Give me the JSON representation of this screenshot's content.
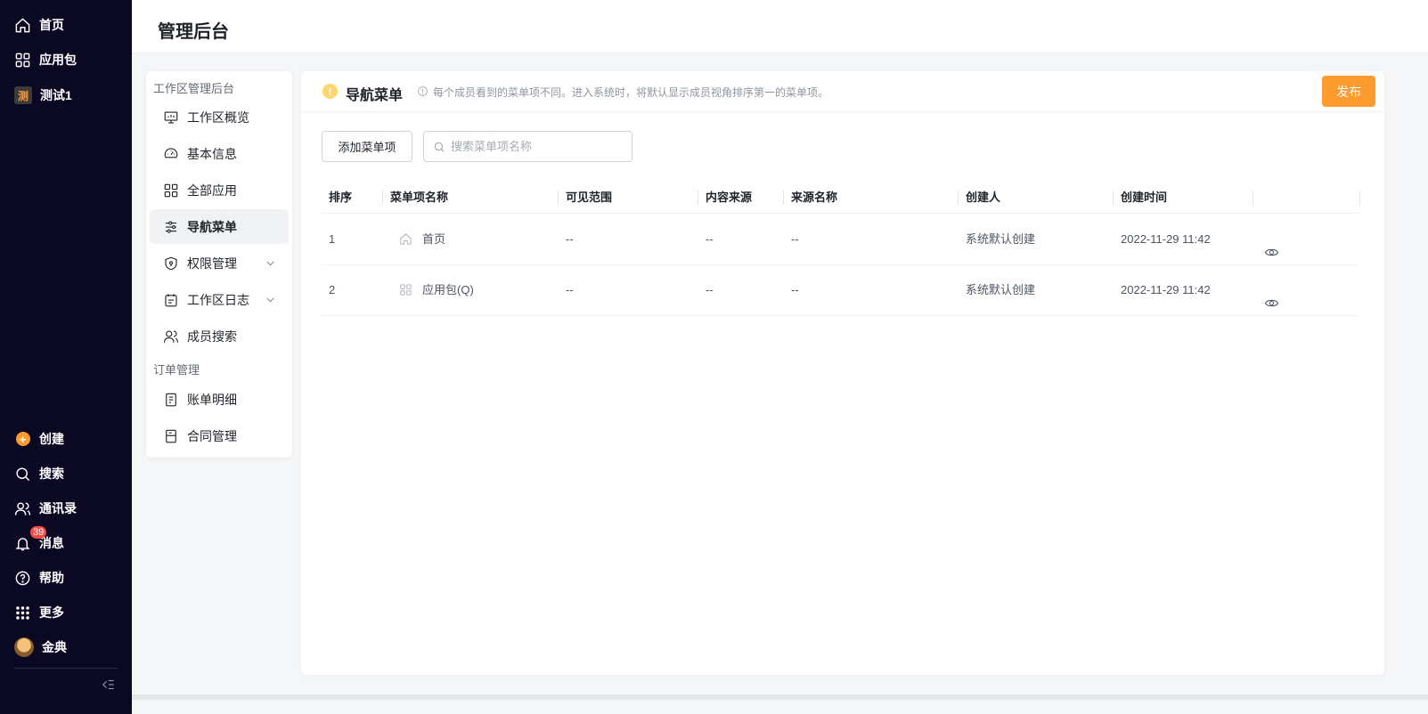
{
  "leftnav": {
    "top_items": [
      {
        "label": "首页",
        "icon": "home-icon"
      },
      {
        "label": "应用包",
        "icon": "grid-icon"
      },
      {
        "label": "测试1",
        "icon": "app-logo",
        "logo_char": "测"
      }
    ],
    "bottom_items": [
      {
        "label": "创建",
        "icon": "plus-circle-icon"
      },
      {
        "label": "搜索",
        "icon": "search-icon"
      },
      {
        "label": "通讯录",
        "icon": "contacts-icon"
      },
      {
        "label": "消息",
        "icon": "bell-icon",
        "badge": "39"
      },
      {
        "label": "帮助",
        "icon": "help-icon"
      },
      {
        "label": "更多",
        "icon": "dots-grid-icon"
      },
      {
        "label": "金典",
        "icon": "avatar"
      }
    ]
  },
  "topbar": {
    "title": "管理后台"
  },
  "subnav": {
    "group1": "工作区管理后台",
    "group2": "订单管理",
    "items": [
      {
        "label": "工作区概览",
        "icon": "monitor-icon"
      },
      {
        "label": "基本信息",
        "icon": "dashboard-icon"
      },
      {
        "label": "全部应用",
        "icon": "grid-icon"
      },
      {
        "label": "导航菜单",
        "icon": "sliders-icon",
        "active": true
      },
      {
        "label": "权限管理",
        "icon": "shield-icon",
        "expandable": true
      },
      {
        "label": "工作区日志",
        "icon": "calendar-icon",
        "expandable": true
      },
      {
        "label": "成员搜索",
        "icon": "users-icon"
      },
      {
        "label": "账单明细",
        "icon": "receipt-icon"
      },
      {
        "label": "合同管理",
        "icon": "contract-icon"
      }
    ]
  },
  "main": {
    "title": "导航菜单",
    "tip": "每个成员看到的菜单项不同。进入系统时，将默认显示成员视角排序第一的菜单项。",
    "publish_label": "发布",
    "add_label": "添加菜单项",
    "search_placeholder": "搜索菜单项名称",
    "columns": [
      "排序",
      "菜单项名称",
      "可见范围",
      "内容来源",
      "来源名称",
      "创建人",
      "创建时间"
    ],
    "rows": [
      {
        "order": "1",
        "icon": "home-icon",
        "name": "首页",
        "scope": "--",
        "source": "--",
        "source_name": "--",
        "creator": "系统默认创建",
        "created": "2022-11-29 11:42"
      },
      {
        "order": "2",
        "icon": "grid-icon",
        "name": "应用包(Q)",
        "scope": "--",
        "source": "--",
        "source_name": "--",
        "creator": "系统默认创建",
        "created": "2022-11-29 11:42"
      }
    ]
  },
  "colors": {
    "nav_bg": "#0a0823",
    "accent": "#ff9a2e",
    "badge": "#f54a45"
  }
}
